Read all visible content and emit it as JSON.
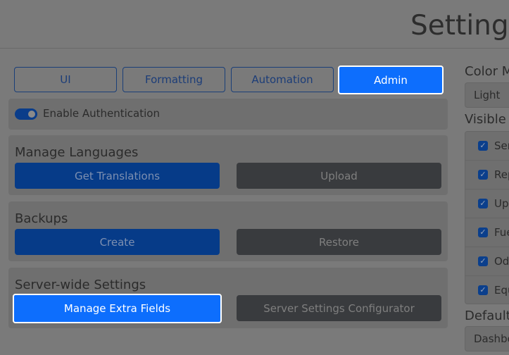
{
  "header": {
    "title": "Settings"
  },
  "tabs": [
    {
      "label": "UI"
    },
    {
      "label": "Formatting"
    },
    {
      "label": "Automation"
    },
    {
      "label": "Admin"
    }
  ],
  "auth": {
    "label": "Enable Authentication",
    "enabled": true
  },
  "languages": {
    "title": "Manage Languages",
    "get_translations": "Get Translations",
    "upload": "Upload"
  },
  "backups": {
    "title": "Backups",
    "create": "Create",
    "restore": "Restore"
  },
  "server": {
    "title": "Server-wide Settings",
    "manage_extra_fields": "Manage Extra Fields",
    "configurator": "Server Settings Configurator"
  },
  "right": {
    "color_mode_label": "Color M",
    "color_mode_value": "Light",
    "visible_label": "Visible T",
    "visible_items": [
      "Ser",
      "Rep",
      "Upc",
      "Fue",
      "Od",
      "Equ"
    ],
    "default_label": "Default",
    "default_value": "Dashbo"
  },
  "colors": {
    "accent": "#0d6efd",
    "primary_dimmed": "#063b88",
    "secondary_dimmed": "#393b3e",
    "overlay_bg": "#7a7a7a"
  },
  "icons": {
    "checkbox": "checkmark-icon"
  }
}
